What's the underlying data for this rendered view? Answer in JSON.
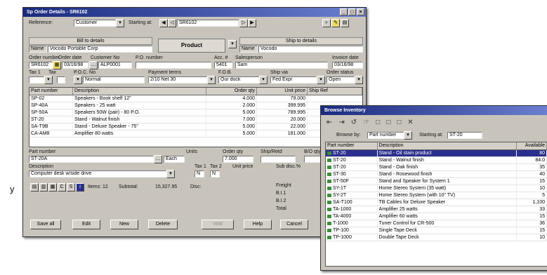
{
  "side_mark": "y",
  "sales_order": {
    "title": "Sp Order Details - SR6102",
    "title_buttons": [
      "_",
      "□",
      "×"
    ],
    "top": {
      "lbl_1": "Reference:",
      "val_1": "Customer",
      "lbl_2": "Starting at:",
      "val_2": "SR6102"
    },
    "bill_to": {
      "header": "Bill to details",
      "tag": "Name",
      "value": "Vocodo Portable Corp"
    },
    "center": {
      "label": "Product"
    },
    "ship_to": {
      "header": "Ship to details",
      "tag": "Name",
      "value": "Vocodo"
    },
    "row1": {
      "labels": [
        "Order number",
        "Order date",
        "Customer No",
        "P.O. number",
        "Acc. #",
        "Salesperson",
        "Invoice date"
      ],
      "values": [
        "SR6102",
        "03/16/98",
        "ALP0001",
        "",
        "5401",
        "Sam",
        "03/16/98"
      ]
    },
    "row2": {
      "labels": [
        "Tax 1",
        "Tax",
        "P.O.C. No",
        "Payment terms",
        "F.O.B.",
        "Ship via",
        "Order status"
      ],
      "values": [
        "",
        "",
        "Normal",
        "2/10 Net 30",
        "Our dock",
        "Fed Expr",
        "Open"
      ]
    },
    "lines_grid": {
      "columns": [
        "Part number",
        "Description",
        "Order qty",
        "Unit price",
        "Ship Ref"
      ],
      "rows": [
        [
          "SP-02",
          "Speakers - Book shelf 12\"",
          "4.000",
          "79.000",
          ""
        ],
        [
          "SP-40A",
          "Speakers - 25 watt",
          "2.000",
          "399.995",
          ""
        ],
        [
          "SP-50A",
          "Speakers 50W (pair) - 80 P.O.",
          "5.000",
          "789.995",
          ""
        ],
        [
          "ST-20",
          "Stand - Walnut finish",
          "7.000",
          "20.000",
          ""
        ],
        [
          "SA-T9B",
          "Stand - Deluxe Speaker - 75\"",
          "5.000",
          "22.000",
          ""
        ],
        [
          "CA-AM8",
          "Amplifier 80 watts",
          "5.000",
          "181.000",
          ""
        ]
      ]
    },
    "detail": {
      "labels": [
        "Part number",
        "Units",
        "Order qty",
        "Ship/Retd",
        "B/O qty"
      ],
      "values": [
        "ST-20A",
        "Each",
        "7.000",
        "",
        ""
      ],
      "desc_label": "Description",
      "desc_value": "Computer desk w/side drive",
      "tax_labels": [
        "Tax 1",
        "Tax 2",
        "Unit price",
        "Sub disc.%"
      ],
      "tax_values": [
        "N",
        "N",
        "",
        ""
      ]
    },
    "status": {
      "items": "Items: 12",
      "subtotal": "Subtotal:",
      "amount": "15,327.95",
      "disc": "Disc:"
    },
    "totals": {
      "labels": [
        "Freight",
        "B.I.1",
        "B.I.2",
        "Total"
      ]
    },
    "buttons": [
      "Save all",
      "Edit",
      "New",
      "Delete",
      "Void",
      "Help",
      "Cancel"
    ]
  },
  "browse": {
    "title": "Browse Inventory",
    "toolbar_glyphs": [
      "⇤",
      "⇥",
      "↺",
      "☞",
      "□",
      "□",
      "□",
      "✕"
    ],
    "browse_by_label": "Browse by:",
    "browse_by_value": "Part number",
    "starting_label": "Starting at:",
    "starting_value": "ST-20",
    "columns": [
      "Part number",
      "Description",
      "Available"
    ],
    "rows": [
      [
        "ST-20",
        "Stand - Oil stain product",
        "80",
        true
      ],
      [
        "ST-20",
        "Stand - Walnut finish",
        "84.0",
        false
      ],
      [
        "ST-20",
        "Stand - Oak finish",
        "35",
        false
      ],
      [
        "ST-30",
        "Stand - Rosewood finish",
        "40",
        false
      ],
      [
        "ST-50F",
        "Stand and Speaker for System 1",
        "15",
        false
      ],
      [
        "SY-1T",
        "Home Stereo System (35 watt)",
        "10",
        false
      ],
      [
        "SY-2T",
        "Home Stereo System (with 10\" TV)",
        "5",
        false
      ],
      [
        "SA-T100",
        "TB Cables for Deluxe Speaker",
        "1,100",
        false
      ],
      [
        "TA-1000",
        "Amplifier 25 watts",
        "33",
        false
      ],
      [
        "TA-4000",
        "Amplifier 60 watts",
        "15",
        false
      ],
      [
        "T-1000",
        "Tuner Control for CR-500",
        "36",
        false
      ],
      [
        "TP-100",
        "Single Tape Deck",
        "15",
        false
      ],
      [
        "TP-1000",
        "Double Tape Deck",
        "10",
        false
      ]
    ]
  }
}
